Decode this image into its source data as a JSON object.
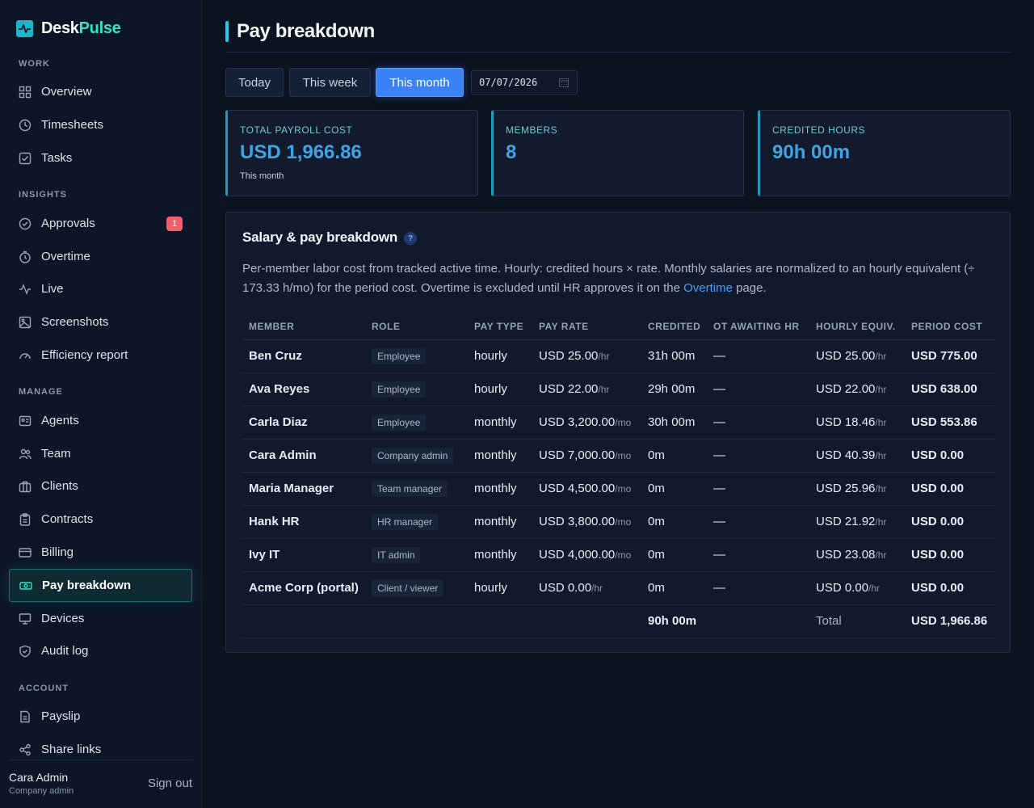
{
  "brand": {
    "name_a": "Desk",
    "name_b": "Pulse"
  },
  "sidebar": {
    "sections": {
      "work": "WORK",
      "insights": "INSIGHTS",
      "manage": "MANAGE",
      "account": "ACCOUNT"
    },
    "items": [
      {
        "label": "Overview",
        "icon": "grid-icon"
      },
      {
        "label": "Timesheets",
        "icon": "clock-icon"
      },
      {
        "label": "Tasks",
        "icon": "checkbox-icon"
      },
      {
        "label": "Approvals",
        "icon": "check-circle-icon",
        "badge": "1"
      },
      {
        "label": "Overtime",
        "icon": "stopwatch-icon"
      },
      {
        "label": "Live",
        "icon": "pulse-icon"
      },
      {
        "label": "Screenshots",
        "icon": "image-icon"
      },
      {
        "label": "Efficiency report",
        "icon": "gauge-icon"
      },
      {
        "label": "Agents",
        "icon": "id-card-icon"
      },
      {
        "label": "Team",
        "icon": "users-icon"
      },
      {
        "label": "Clients",
        "icon": "briefcase-icon"
      },
      {
        "label": "Contracts",
        "icon": "clipboard-icon"
      },
      {
        "label": "Billing",
        "icon": "credit-card-icon"
      },
      {
        "label": "Pay breakdown",
        "icon": "banknote-icon",
        "active": true
      },
      {
        "label": "Devices",
        "icon": "monitor-icon"
      },
      {
        "label": "Audit log",
        "icon": "shield-icon"
      },
      {
        "label": "Payslip",
        "icon": "document-icon"
      },
      {
        "label": "Share links",
        "icon": "share-icon"
      }
    ],
    "user": {
      "name": "Cara Admin",
      "role": "Company admin"
    },
    "signout": "Sign out"
  },
  "page": {
    "title": "Pay breakdown"
  },
  "filters": {
    "today": "Today",
    "week": "This week",
    "month": "This month",
    "active": "This month",
    "date": "07/07/2026"
  },
  "stats": {
    "payroll": {
      "label": "TOTAL PAYROLL COST",
      "value": "USD 1,966.86",
      "sub": "This month"
    },
    "members": {
      "label": "MEMBERS",
      "value": "8"
    },
    "hours": {
      "label": "CREDITED HOURS",
      "value": "90h 00m"
    }
  },
  "panel": {
    "title": "Salary & pay breakdown",
    "help": "?",
    "desc_1": "Per-member labor cost from tracked active time. Hourly: credited hours × rate. Monthly salaries are normalized to an hourly equivalent (÷ 173.33 h/mo) for the period cost. Overtime is excluded until HR approves it on the ",
    "desc_link": "Overtime",
    "desc_2": " page."
  },
  "table": {
    "headers": [
      "MEMBER",
      "ROLE",
      "PAY TYPE",
      "PAY RATE",
      "CREDITED",
      "OT AWAITING HR",
      "HOURLY EQUIV.",
      "PERIOD COST"
    ],
    "rows": [
      {
        "member": "Ben Cruz",
        "role": "Employee",
        "pay_type": "hourly",
        "rate": "USD 25.00",
        "rate_unit": "/hr",
        "credited": "31h 00m",
        "ot": "—",
        "equiv": "USD 25.00",
        "equiv_unit": "/hr",
        "cost": "USD 775.00"
      },
      {
        "member": "Ava Reyes",
        "role": "Employee",
        "pay_type": "hourly",
        "rate": "USD 22.00",
        "rate_unit": "/hr",
        "credited": "29h 00m",
        "ot": "—",
        "equiv": "USD 22.00",
        "equiv_unit": "/hr",
        "cost": "USD 638.00"
      },
      {
        "member": "Carla Diaz",
        "role": "Employee",
        "pay_type": "monthly",
        "rate": "USD 3,200.00",
        "rate_unit": "/mo",
        "credited": "30h 00m",
        "ot": "—",
        "equiv": "USD 18.46",
        "equiv_unit": "/hr",
        "cost": "USD 553.86"
      },
      {
        "member": "Cara Admin",
        "role": "Company admin",
        "pay_type": "monthly",
        "rate": "USD 7,000.00",
        "rate_unit": "/mo",
        "credited": "0m",
        "ot": "—",
        "equiv": "USD 40.39",
        "equiv_unit": "/hr",
        "cost": "USD 0.00"
      },
      {
        "member": "Maria Manager",
        "role": "Team manager",
        "pay_type": "monthly",
        "rate": "USD 4,500.00",
        "rate_unit": "/mo",
        "credited": "0m",
        "ot": "—",
        "equiv": "USD 25.96",
        "equiv_unit": "/hr",
        "cost": "USD 0.00"
      },
      {
        "member": "Hank HR",
        "role": "HR manager",
        "pay_type": "monthly",
        "rate": "USD 3,800.00",
        "rate_unit": "/mo",
        "credited": "0m",
        "ot": "—",
        "equiv": "USD 21.92",
        "equiv_unit": "/hr",
        "cost": "USD 0.00"
      },
      {
        "member": "Ivy IT",
        "role": "IT admin",
        "pay_type": "monthly",
        "rate": "USD 4,000.00",
        "rate_unit": "/mo",
        "credited": "0m",
        "ot": "—",
        "equiv": "USD 23.08",
        "equiv_unit": "/hr",
        "cost": "USD 0.00"
      },
      {
        "member": "Acme Corp (portal)",
        "role": "Client / viewer",
        "pay_type": "hourly",
        "rate": "USD 0.00",
        "rate_unit": "/hr",
        "credited": "0m",
        "ot": "—",
        "equiv": "USD 0.00",
        "equiv_unit": "/hr",
        "cost": "USD 0.00"
      }
    ],
    "total": {
      "credited": "90h 00m",
      "label": "Total",
      "cost": "USD 1,966.86"
    }
  },
  "colors": {
    "accent": "#3b82f6",
    "teal": "#2ee6c7",
    "badge": "#f0606a",
    "bg": "#0b1220"
  }
}
